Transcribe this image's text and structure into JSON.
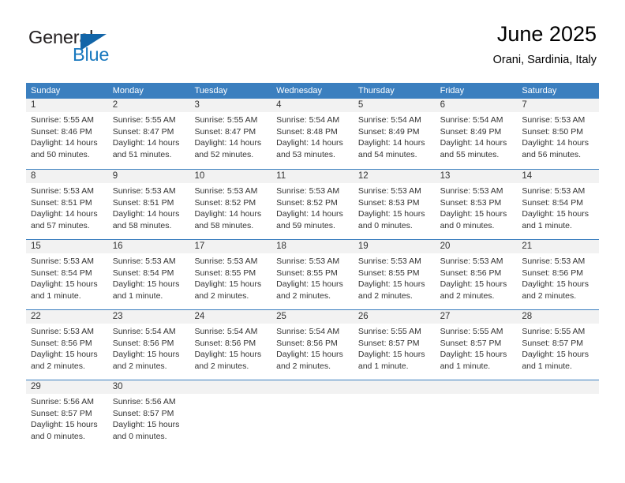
{
  "brand": {
    "name_part1": "General",
    "name_part2": "Blue",
    "triangle_color": "#1265a8",
    "blue_color": "#1878be"
  },
  "header": {
    "title": "June 2025",
    "subtitle": "Orani, Sardinia, Italy"
  },
  "theme": {
    "header_band": "#3b7fbf",
    "day_band": "#f2f2f2",
    "text": "#333333"
  },
  "weekdays": [
    "Sunday",
    "Monday",
    "Tuesday",
    "Wednesday",
    "Thursday",
    "Friday",
    "Saturday"
  ],
  "weeks": [
    [
      {
        "day": "1",
        "sunrise": "Sunrise: 5:55 AM",
        "sunset": "Sunset: 8:46 PM",
        "daylight_1": "Daylight: 14 hours",
        "daylight_2": "and 50 minutes."
      },
      {
        "day": "2",
        "sunrise": "Sunrise: 5:55 AM",
        "sunset": "Sunset: 8:47 PM",
        "daylight_1": "Daylight: 14 hours",
        "daylight_2": "and 51 minutes."
      },
      {
        "day": "3",
        "sunrise": "Sunrise: 5:55 AM",
        "sunset": "Sunset: 8:47 PM",
        "daylight_1": "Daylight: 14 hours",
        "daylight_2": "and 52 minutes."
      },
      {
        "day": "4",
        "sunrise": "Sunrise: 5:54 AM",
        "sunset": "Sunset: 8:48 PM",
        "daylight_1": "Daylight: 14 hours",
        "daylight_2": "and 53 minutes."
      },
      {
        "day": "5",
        "sunrise": "Sunrise: 5:54 AM",
        "sunset": "Sunset: 8:49 PM",
        "daylight_1": "Daylight: 14 hours",
        "daylight_2": "and 54 minutes."
      },
      {
        "day": "6",
        "sunrise": "Sunrise: 5:54 AM",
        "sunset": "Sunset: 8:49 PM",
        "daylight_1": "Daylight: 14 hours",
        "daylight_2": "and 55 minutes."
      },
      {
        "day": "7",
        "sunrise": "Sunrise: 5:53 AM",
        "sunset": "Sunset: 8:50 PM",
        "daylight_1": "Daylight: 14 hours",
        "daylight_2": "and 56 minutes."
      }
    ],
    [
      {
        "day": "8",
        "sunrise": "Sunrise: 5:53 AM",
        "sunset": "Sunset: 8:51 PM",
        "daylight_1": "Daylight: 14 hours",
        "daylight_2": "and 57 minutes."
      },
      {
        "day": "9",
        "sunrise": "Sunrise: 5:53 AM",
        "sunset": "Sunset: 8:51 PM",
        "daylight_1": "Daylight: 14 hours",
        "daylight_2": "and 58 minutes."
      },
      {
        "day": "10",
        "sunrise": "Sunrise: 5:53 AM",
        "sunset": "Sunset: 8:52 PM",
        "daylight_1": "Daylight: 14 hours",
        "daylight_2": "and 58 minutes."
      },
      {
        "day": "11",
        "sunrise": "Sunrise: 5:53 AM",
        "sunset": "Sunset: 8:52 PM",
        "daylight_1": "Daylight: 14 hours",
        "daylight_2": "and 59 minutes."
      },
      {
        "day": "12",
        "sunrise": "Sunrise: 5:53 AM",
        "sunset": "Sunset: 8:53 PM",
        "daylight_1": "Daylight: 15 hours",
        "daylight_2": "and 0 minutes."
      },
      {
        "day": "13",
        "sunrise": "Sunrise: 5:53 AM",
        "sunset": "Sunset: 8:53 PM",
        "daylight_1": "Daylight: 15 hours",
        "daylight_2": "and 0 minutes."
      },
      {
        "day": "14",
        "sunrise": "Sunrise: 5:53 AM",
        "sunset": "Sunset: 8:54 PM",
        "daylight_1": "Daylight: 15 hours",
        "daylight_2": "and 1 minute."
      }
    ],
    [
      {
        "day": "15",
        "sunrise": "Sunrise: 5:53 AM",
        "sunset": "Sunset: 8:54 PM",
        "daylight_1": "Daylight: 15 hours",
        "daylight_2": "and 1 minute."
      },
      {
        "day": "16",
        "sunrise": "Sunrise: 5:53 AM",
        "sunset": "Sunset: 8:54 PM",
        "daylight_1": "Daylight: 15 hours",
        "daylight_2": "and 1 minute."
      },
      {
        "day": "17",
        "sunrise": "Sunrise: 5:53 AM",
        "sunset": "Sunset: 8:55 PM",
        "daylight_1": "Daylight: 15 hours",
        "daylight_2": "and 2 minutes."
      },
      {
        "day": "18",
        "sunrise": "Sunrise: 5:53 AM",
        "sunset": "Sunset: 8:55 PM",
        "daylight_1": "Daylight: 15 hours",
        "daylight_2": "and 2 minutes."
      },
      {
        "day": "19",
        "sunrise": "Sunrise: 5:53 AM",
        "sunset": "Sunset: 8:55 PM",
        "daylight_1": "Daylight: 15 hours",
        "daylight_2": "and 2 minutes."
      },
      {
        "day": "20",
        "sunrise": "Sunrise: 5:53 AM",
        "sunset": "Sunset: 8:56 PM",
        "daylight_1": "Daylight: 15 hours",
        "daylight_2": "and 2 minutes."
      },
      {
        "day": "21",
        "sunrise": "Sunrise: 5:53 AM",
        "sunset": "Sunset: 8:56 PM",
        "daylight_1": "Daylight: 15 hours",
        "daylight_2": "and 2 minutes."
      }
    ],
    [
      {
        "day": "22",
        "sunrise": "Sunrise: 5:53 AM",
        "sunset": "Sunset: 8:56 PM",
        "daylight_1": "Daylight: 15 hours",
        "daylight_2": "and 2 minutes."
      },
      {
        "day": "23",
        "sunrise": "Sunrise: 5:54 AM",
        "sunset": "Sunset: 8:56 PM",
        "daylight_1": "Daylight: 15 hours",
        "daylight_2": "and 2 minutes."
      },
      {
        "day": "24",
        "sunrise": "Sunrise: 5:54 AM",
        "sunset": "Sunset: 8:56 PM",
        "daylight_1": "Daylight: 15 hours",
        "daylight_2": "and 2 minutes."
      },
      {
        "day": "25",
        "sunrise": "Sunrise: 5:54 AM",
        "sunset": "Sunset: 8:56 PM",
        "daylight_1": "Daylight: 15 hours",
        "daylight_2": "and 2 minutes."
      },
      {
        "day": "26",
        "sunrise": "Sunrise: 5:55 AM",
        "sunset": "Sunset: 8:57 PM",
        "daylight_1": "Daylight: 15 hours",
        "daylight_2": "and 1 minute."
      },
      {
        "day": "27",
        "sunrise": "Sunrise: 5:55 AM",
        "sunset": "Sunset: 8:57 PM",
        "daylight_1": "Daylight: 15 hours",
        "daylight_2": "and 1 minute."
      },
      {
        "day": "28",
        "sunrise": "Sunrise: 5:55 AM",
        "sunset": "Sunset: 8:57 PM",
        "daylight_1": "Daylight: 15 hours",
        "daylight_2": "and 1 minute."
      }
    ],
    [
      {
        "day": "29",
        "sunrise": "Sunrise: 5:56 AM",
        "sunset": "Sunset: 8:57 PM",
        "daylight_1": "Daylight: 15 hours",
        "daylight_2": "and 0 minutes."
      },
      {
        "day": "30",
        "sunrise": "Sunrise: 5:56 AM",
        "sunset": "Sunset: 8:57 PM",
        "daylight_1": "Daylight: 15 hours",
        "daylight_2": "and 0 minutes."
      },
      {
        "day": "",
        "sunrise": "",
        "sunset": "",
        "daylight_1": "",
        "daylight_2": ""
      },
      {
        "day": "",
        "sunrise": "",
        "sunset": "",
        "daylight_1": "",
        "daylight_2": ""
      },
      {
        "day": "",
        "sunrise": "",
        "sunset": "",
        "daylight_1": "",
        "daylight_2": ""
      },
      {
        "day": "",
        "sunrise": "",
        "sunset": "",
        "daylight_1": "",
        "daylight_2": ""
      },
      {
        "day": "",
        "sunrise": "",
        "sunset": "",
        "daylight_1": "",
        "daylight_2": ""
      }
    ]
  ]
}
